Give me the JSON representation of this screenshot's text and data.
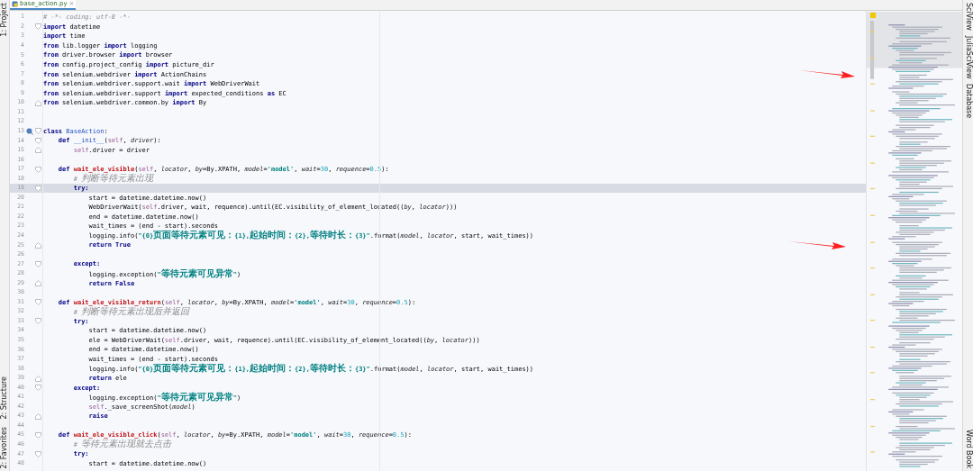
{
  "left_tool_strip": {
    "top": [
      {
        "label": "1: Project"
      }
    ],
    "bottom": [
      {
        "label": "2: Structure"
      },
      {
        "label": "2: Favorites"
      }
    ]
  },
  "tabs": [
    {
      "label": "base_action.py",
      "selected": true,
      "close": "×"
    }
  ],
  "right_tool_strip": {
    "top": [
      {
        "label": "SciView"
      },
      {
        "label": "JuliaSciView"
      },
      {
        "label": "Database"
      }
    ],
    "bottom": [
      {
        "label": "Word Book"
      }
    ]
  },
  "editor": {
    "lines": [
      {
        "n": "1",
        "current": false,
        "kind": "line",
        "marker": false,
        "tokens": [
          {
            "kind": "comment",
            "text": "# -*- coding: utf-8 -*-"
          }
        ]
      },
      {
        "n": "2",
        "current": false,
        "kind": "foldstart",
        "marker": false,
        "tokens": [
          {
            "kind": "kw",
            "text": "import"
          },
          {
            "kind": "plain",
            "text": " datetime"
          }
        ]
      },
      {
        "n": "3",
        "current": false,
        "kind": "line",
        "marker": false,
        "tokens": [
          {
            "kind": "kw",
            "text": "import"
          },
          {
            "kind": "plain",
            "text": " time"
          }
        ]
      },
      {
        "n": "4",
        "current": false,
        "kind": "line",
        "marker": false,
        "tokens": [
          {
            "kind": "kw",
            "text": "from"
          },
          {
            "kind": "plain",
            "text": " lib.logger "
          },
          {
            "kind": "kw",
            "text": "import"
          },
          {
            "kind": "plain",
            "text": " logging"
          }
        ]
      },
      {
        "n": "5",
        "current": false,
        "kind": "line",
        "marker": false,
        "tokens": [
          {
            "kind": "kw",
            "text": "from"
          },
          {
            "kind": "plain",
            "text": " driver.browser "
          },
          {
            "kind": "kw",
            "text": "import"
          },
          {
            "kind": "plain",
            "text": " browser"
          }
        ]
      },
      {
        "n": "6",
        "current": false,
        "kind": "line",
        "marker": false,
        "tokens": [
          {
            "kind": "kw",
            "text": "from"
          },
          {
            "kind": "plain",
            "text": " config.project_config "
          },
          {
            "kind": "kw",
            "text": "import"
          },
          {
            "kind": "plain",
            "text": " picture_dir"
          }
        ]
      },
      {
        "n": "7",
        "current": false,
        "kind": "line",
        "marker": false,
        "tokens": [
          {
            "kind": "kw",
            "text": "from"
          },
          {
            "kind": "plain",
            "text": " selenium.webdriver "
          },
          {
            "kind": "kw",
            "text": "import"
          },
          {
            "kind": "plain",
            "text": " ActionChains"
          }
        ]
      },
      {
        "n": "8",
        "current": false,
        "kind": "line",
        "marker": false,
        "tokens": [
          {
            "kind": "kw",
            "text": "from"
          },
          {
            "kind": "plain",
            "text": " selenium.webdriver.support.wait "
          },
          {
            "kind": "kw",
            "text": "import"
          },
          {
            "kind": "plain",
            "text": " WebDriverWait"
          }
        ]
      },
      {
        "n": "9",
        "current": false,
        "kind": "line",
        "marker": false,
        "tokens": [
          {
            "kind": "kw",
            "text": "from"
          },
          {
            "kind": "plain",
            "text": " selenium.webdriver.support "
          },
          {
            "kind": "kw",
            "text": "import"
          },
          {
            "kind": "plain",
            "text": " expected_conditions "
          },
          {
            "kind": "kw",
            "text": "as"
          },
          {
            "kind": "plain",
            "text": " EC"
          }
        ]
      },
      {
        "n": "10",
        "current": false,
        "kind": "foldend",
        "marker": false,
        "tokens": [
          {
            "kind": "kw",
            "text": "from"
          },
          {
            "kind": "plain",
            "text": " selenium.webdriver.common.by "
          },
          {
            "kind": "kw",
            "text": "import"
          },
          {
            "kind": "plain",
            "text": " By"
          }
        ]
      },
      {
        "n": "11",
        "current": false,
        "kind": "line",
        "marker": false
      },
      {
        "n": "12",
        "current": false,
        "kind": "line",
        "marker": false
      },
      {
        "n": "13",
        "current": false,
        "kind": "foldstart",
        "marker": true,
        "tokens": [
          {
            "kind": "kw",
            "text": "class "
          },
          {
            "kind": "cls",
            "text": "BaseAction"
          },
          {
            "kind": "plain",
            "text": ":"
          }
        ]
      },
      {
        "n": "14",
        "current": false,
        "kind": "foldstart",
        "marker": false,
        "tokens": [
          {
            "kind": "kw",
            "text": "    def "
          },
          {
            "kind": "magic",
            "text": "__init__"
          },
          {
            "kind": "plain",
            "text": "("
          },
          {
            "kind": "self",
            "text": "self"
          },
          {
            "kind": "plain",
            "text": ", "
          },
          {
            "kind": "param",
            "text": "driver"
          },
          {
            "kind": "plain",
            "text": "):"
          }
        ]
      },
      {
        "n": "15",
        "current": false,
        "kind": "foldend",
        "marker": false,
        "tokens": [
          {
            "kind": "self",
            "text": "        self"
          },
          {
            "kind": "plain",
            "text": ".driver = driver"
          }
        ]
      },
      {
        "n": "16",
        "current": false,
        "kind": "line",
        "marker": false
      },
      {
        "n": "17",
        "current": false,
        "kind": "foldstart",
        "marker": false,
        "tokens": [
          {
            "kind": "kw",
            "text": "    def "
          },
          {
            "kind": "fn",
            "text": "wait_ele_visible"
          },
          {
            "kind": "plain",
            "text": "("
          },
          {
            "kind": "self",
            "text": "self"
          },
          {
            "kind": "plain",
            "text": ", "
          },
          {
            "kind": "param",
            "text": "locator"
          },
          {
            "kind": "plain",
            "text": ", "
          },
          {
            "kind": "param",
            "text": "by"
          },
          {
            "kind": "plain",
            "text": "=By.XPATH, "
          },
          {
            "kind": "param",
            "text": "model"
          },
          {
            "kind": "plain",
            "text": "="
          },
          {
            "kind": "str",
            "text": "'model'"
          },
          {
            "kind": "plain",
            "text": ", "
          },
          {
            "kind": "param",
            "text": "wait"
          },
          {
            "kind": "plain",
            "text": "="
          },
          {
            "kind": "num",
            "text": "30"
          },
          {
            "kind": "plain",
            "text": ", "
          },
          {
            "kind": "param",
            "text": "requence"
          },
          {
            "kind": "plain",
            "text": "="
          },
          {
            "kind": "num",
            "text": "0.5"
          },
          {
            "kind": "plain",
            "text": "):"
          }
        ]
      },
      {
        "n": "18",
        "current": false,
        "kind": "line",
        "marker": false,
        "tokens": [
          {
            "kind": "comment",
            "text": "        # 判断等待元素出现"
          }
        ]
      },
      {
        "n": "19",
        "current": true,
        "kind": "foldstart",
        "marker": false,
        "tokens": [
          {
            "kind": "kw",
            "text": "        try:"
          }
        ]
      },
      {
        "n": "20",
        "current": false,
        "kind": "line",
        "marker": false,
        "tokens": [
          {
            "kind": "plain",
            "text": "            start = datetime.datetime.now()"
          }
        ]
      },
      {
        "n": "21",
        "current": false,
        "kind": "line",
        "marker": false,
        "tokens": [
          {
            "kind": "plain",
            "text": "            WebDriverWait("
          },
          {
            "kind": "self",
            "text": "self"
          },
          {
            "kind": "plain",
            "text": ".driver, wait, requence).until(EC.visibility_of_element_located(("
          },
          {
            "kind": "param",
            "text": "by"
          },
          {
            "kind": "plain",
            "text": ", "
          },
          {
            "kind": "param",
            "text": "locator"
          },
          {
            "kind": "plain",
            "text": ")))"
          }
        ]
      },
      {
        "n": "22",
        "current": false,
        "kind": "line",
        "marker": false,
        "tokens": [
          {
            "kind": "plain",
            "text": "            end = datetime.datetime.now()"
          }
        ]
      },
      {
        "n": "23",
        "current": false,
        "kind": "line",
        "marker": false,
        "tokens": [
          {
            "kind": "plain",
            "text": "            wait_times = (end - start).seconds"
          }
        ]
      },
      {
        "n": "24",
        "current": false,
        "kind": "line",
        "marker": false,
        "tokens": [
          {
            "kind": "plain",
            "text": "            logging.info("
          },
          {
            "kind": "str",
            "text": "\"{0}页面等待元素可见：{1},起始时间：{2},等待时长：{3}\""
          },
          {
            "kind": "plain",
            "text": ".format("
          },
          {
            "kind": "param",
            "text": "model"
          },
          {
            "kind": "plain",
            "text": ", "
          },
          {
            "kind": "param",
            "text": "locator"
          },
          {
            "kind": "plain",
            "text": ", start, wait_times))"
          }
        ]
      },
      {
        "n": "25",
        "current": false,
        "kind": "foldend",
        "marker": false,
        "tokens": [
          {
            "kind": "kw",
            "text": "            return True"
          }
        ]
      },
      {
        "n": "26",
        "current": false,
        "kind": "line",
        "marker": false
      },
      {
        "n": "27",
        "current": false,
        "kind": "foldstart",
        "marker": false,
        "tokens": [
          {
            "kind": "kw",
            "text": "        except:"
          }
        ]
      },
      {
        "n": "28",
        "current": false,
        "kind": "line",
        "marker": false,
        "tokens": [
          {
            "kind": "plain",
            "text": "            logging.exception("
          },
          {
            "kind": "str",
            "text": "\"等待元素可见异常\""
          },
          {
            "kind": "plain",
            "text": ")"
          }
        ]
      },
      {
        "n": "29",
        "current": false,
        "kind": "foldend",
        "marker": false,
        "tokens": [
          {
            "kind": "kw",
            "text": "            return False"
          }
        ]
      },
      {
        "n": "30",
        "current": false,
        "kind": "line",
        "marker": false
      },
      {
        "n": "31",
        "current": false,
        "kind": "foldstart",
        "marker": false,
        "tokens": [
          {
            "kind": "kw",
            "text": "    def "
          },
          {
            "kind": "fn",
            "text": "wait_ele_visible_return"
          },
          {
            "kind": "plain",
            "text": "("
          },
          {
            "kind": "self",
            "text": "self"
          },
          {
            "kind": "plain",
            "text": ", "
          },
          {
            "kind": "param",
            "text": "locator"
          },
          {
            "kind": "plain",
            "text": ", "
          },
          {
            "kind": "param",
            "text": "by"
          },
          {
            "kind": "plain",
            "text": "=By.XPATH, "
          },
          {
            "kind": "param",
            "text": "model"
          },
          {
            "kind": "plain",
            "text": "="
          },
          {
            "kind": "str",
            "text": "'model'"
          },
          {
            "kind": "plain",
            "text": ", "
          },
          {
            "kind": "param",
            "text": "wait"
          },
          {
            "kind": "plain",
            "text": "="
          },
          {
            "kind": "num",
            "text": "30"
          },
          {
            "kind": "plain",
            "text": ", "
          },
          {
            "kind": "param",
            "text": "requence"
          },
          {
            "kind": "plain",
            "text": "="
          },
          {
            "kind": "num",
            "text": "0.5"
          },
          {
            "kind": "plain",
            "text": "):"
          }
        ]
      },
      {
        "n": "32",
        "current": false,
        "kind": "line",
        "marker": false,
        "tokens": [
          {
            "kind": "comment",
            "text": "        # 判断等待元素出现后并返回"
          }
        ]
      },
      {
        "n": "33",
        "current": false,
        "kind": "foldstart",
        "marker": false,
        "tokens": [
          {
            "kind": "kw",
            "text": "        try:"
          }
        ]
      },
      {
        "n": "34",
        "current": false,
        "kind": "line",
        "marker": false,
        "tokens": [
          {
            "kind": "plain",
            "text": "            start = datetime.datetime.now()"
          }
        ]
      },
      {
        "n": "35",
        "current": false,
        "kind": "line",
        "marker": false,
        "tokens": [
          {
            "kind": "plain",
            "text": "            ele = WebDriverWait("
          },
          {
            "kind": "self",
            "text": "self"
          },
          {
            "kind": "plain",
            "text": ".driver, wait, requence).until(EC.visibility_of_element_located(("
          },
          {
            "kind": "param",
            "text": "by"
          },
          {
            "kind": "plain",
            "text": ", "
          },
          {
            "kind": "param",
            "text": "locator"
          },
          {
            "kind": "plain",
            "text": ")))"
          }
        ]
      },
      {
        "n": "36",
        "current": false,
        "kind": "line",
        "marker": false,
        "tokens": [
          {
            "kind": "plain",
            "text": "            end = datetime.datetime.now()"
          }
        ]
      },
      {
        "n": "37",
        "current": false,
        "kind": "line",
        "marker": false,
        "tokens": [
          {
            "kind": "plain",
            "text": "            wait_times = (end - start).seconds"
          }
        ]
      },
      {
        "n": "38",
        "current": false,
        "kind": "line",
        "marker": false,
        "tokens": [
          {
            "kind": "plain",
            "text": "            logging.info("
          },
          {
            "kind": "str",
            "text": "\"{0}页面等待元素可见：{1},起始时间：{2},等待时长：{3}\""
          },
          {
            "kind": "plain",
            "text": ".format("
          },
          {
            "kind": "param",
            "text": "model"
          },
          {
            "kind": "plain",
            "text": ", "
          },
          {
            "kind": "param",
            "text": "locator"
          },
          {
            "kind": "plain",
            "text": ", start, wait_times))"
          }
        ]
      },
      {
        "n": "39",
        "current": false,
        "kind": "foldend",
        "marker": false,
        "tokens": [
          {
            "kind": "kw",
            "text": "            return"
          },
          {
            "kind": "plain",
            "text": " ele"
          }
        ]
      },
      {
        "n": "40",
        "current": false,
        "kind": "foldstart",
        "marker": false,
        "tokens": [
          {
            "kind": "kw",
            "text": "        except:"
          }
        ]
      },
      {
        "n": "41",
        "current": false,
        "kind": "line",
        "marker": false,
        "tokens": [
          {
            "kind": "plain",
            "text": "            logging.exception("
          },
          {
            "kind": "str",
            "text": "\"等待元素可见异常\""
          },
          {
            "kind": "plain",
            "text": ")"
          }
        ]
      },
      {
        "n": "42",
        "current": false,
        "kind": "line",
        "marker": false,
        "tokens": [
          {
            "kind": "self",
            "text": "            self"
          },
          {
            "kind": "plain",
            "text": "._save_screenShot("
          },
          {
            "kind": "param",
            "text": "model"
          },
          {
            "kind": "plain",
            "text": ")"
          }
        ]
      },
      {
        "n": "43",
        "current": false,
        "kind": "foldend",
        "marker": false,
        "tokens": [
          {
            "kind": "kw",
            "text": "            raise"
          }
        ]
      },
      {
        "n": "44",
        "current": false,
        "kind": "line",
        "marker": false
      },
      {
        "n": "45",
        "current": false,
        "kind": "foldstart",
        "marker": false,
        "tokens": [
          {
            "kind": "kw",
            "text": "    def "
          },
          {
            "kind": "fn",
            "text": "wait_ele_visible_click"
          },
          {
            "kind": "plain",
            "text": "("
          },
          {
            "kind": "self",
            "text": "self"
          },
          {
            "kind": "plain",
            "text": ", "
          },
          {
            "kind": "param",
            "text": "locator"
          },
          {
            "kind": "plain",
            "text": ", "
          },
          {
            "kind": "param",
            "text": "by"
          },
          {
            "kind": "plain",
            "text": "=By.XPATH, "
          },
          {
            "kind": "param",
            "text": "model"
          },
          {
            "kind": "plain",
            "text": "="
          },
          {
            "kind": "str",
            "text": "'model'"
          },
          {
            "kind": "plain",
            "text": ", "
          },
          {
            "kind": "param",
            "text": "wait"
          },
          {
            "kind": "plain",
            "text": "="
          },
          {
            "kind": "num",
            "text": "30"
          },
          {
            "kind": "plain",
            "text": ", "
          },
          {
            "kind": "param",
            "text": "requence"
          },
          {
            "kind": "plain",
            "text": "="
          },
          {
            "kind": "num",
            "text": "0.5"
          },
          {
            "kind": "plain",
            "text": "):"
          }
        ]
      },
      {
        "n": "46",
        "current": false,
        "kind": "line",
        "marker": false,
        "tokens": [
          {
            "kind": "comment",
            "text": "        # 等待元素出现就去点击"
          }
        ]
      },
      {
        "n": "47",
        "current": false,
        "kind": "foldstart",
        "marker": false,
        "tokens": [
          {
            "kind": "kw",
            "text": "        try:"
          }
        ]
      },
      {
        "n": "48",
        "current": false,
        "kind": "line",
        "marker": false,
        "tokens": [
          {
            "kind": "plain",
            "text": "            start = datetime.datetime.now()"
          }
        ]
      }
    ]
  }
}
